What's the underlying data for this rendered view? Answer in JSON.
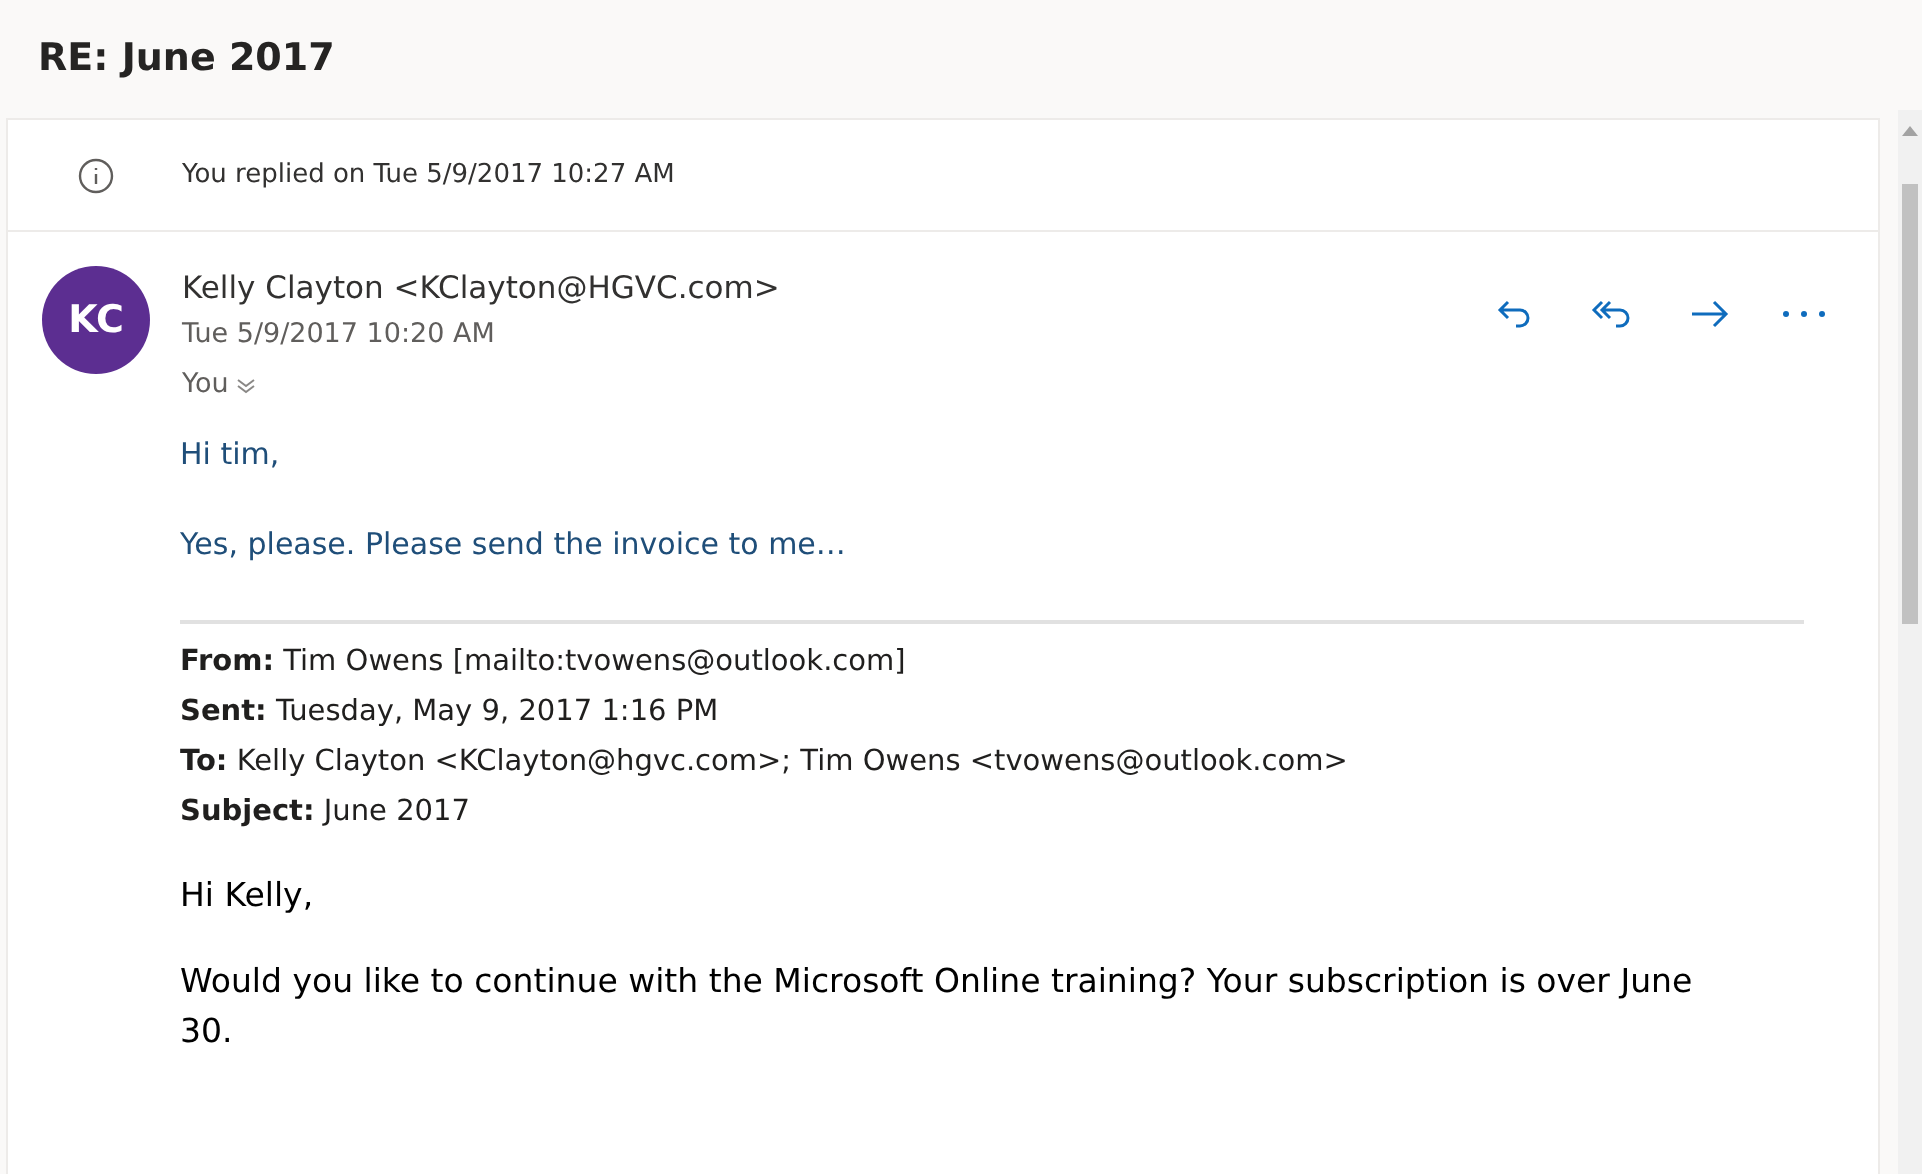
{
  "subject": "RE: June 2017",
  "info": "You replied on Tue 5/9/2017 10:27 AM",
  "sender": {
    "initials": "KC",
    "name": "Kelly Clayton <KClayton@HGVC.com>",
    "date": "Tue 5/9/2017 10:20 AM",
    "to": "You"
  },
  "actions": [
    {
      "kind": "reply"
    },
    {
      "kind": "reply_all"
    },
    {
      "kind": "forward"
    },
    {
      "kind": "more"
    }
  ],
  "reply_lines": [
    "Hi tim,",
    "Yes, please.  Please send the invoice to me…"
  ],
  "quoted_headers": [
    "**From:** Tim Owens [mailto:tvowens@outlook.com]",
    "**Sent:** Tuesday, May 9, 2017 1:16 PM",
    "**To:** Kelly Clayton <KClayton@hgvc.com>; Tim Owens <tvowens@outlook.com>",
    "**Subject:** June 2017"
  ],
  "quoted_lines": [
    "Hi Kelly,",
    "Would you like to continue with the Microsoft Online training? Your subscription is over June 30."
  ]
}
